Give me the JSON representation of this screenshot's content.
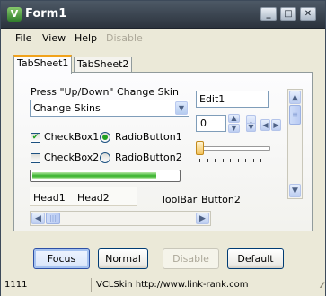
{
  "window": {
    "title": "Form1",
    "icon_name": "app-icon",
    "title_icon_glyph": "V"
  },
  "title_buttons": {
    "minimize": "_",
    "maximize": "□",
    "close": "✕"
  },
  "menu": [
    {
      "label": "File",
      "disabled": false
    },
    {
      "label": "View",
      "disabled": false
    },
    {
      "label": "Help",
      "disabled": false
    },
    {
      "label": "Disable",
      "disabled": true
    }
  ],
  "tabs": [
    {
      "label": "TabSheet1",
      "active": true
    },
    {
      "label": "TabSheet2",
      "active": false
    }
  ],
  "panel": {
    "hint_label": "Press \"Up/Down\" Change Skin",
    "combo_value": "Change Skins",
    "edit_value": "Edit1",
    "spin_value": "0",
    "checkbox1": {
      "label": "CheckBox1",
      "checked": true
    },
    "checkbox2": {
      "label": "CheckBox2",
      "checked": false
    },
    "radio1": {
      "label": "RadioButton1",
      "checked": true
    },
    "radio2": {
      "label": "RadioButton2",
      "checked": false
    },
    "progress_fraction": 0.85,
    "trackbar_fraction": 0.0,
    "header": [
      "Head1",
      "Head2"
    ],
    "toolbar_label": "ToolBar",
    "toolbar_button": "Button2"
  },
  "buttons": [
    {
      "label": "Focus",
      "state": "focused"
    },
    {
      "label": "Normal",
      "state": "normal"
    },
    {
      "label": "Disable",
      "state": "disabled"
    },
    {
      "label": "Default",
      "state": "default"
    }
  ],
  "status": {
    "left": "1111",
    "center": "VCLSkin http://www.link-rank.com"
  },
  "colors": {
    "titlebar": "#2b333d",
    "progress": "#36b22a",
    "check": "#21a121"
  }
}
